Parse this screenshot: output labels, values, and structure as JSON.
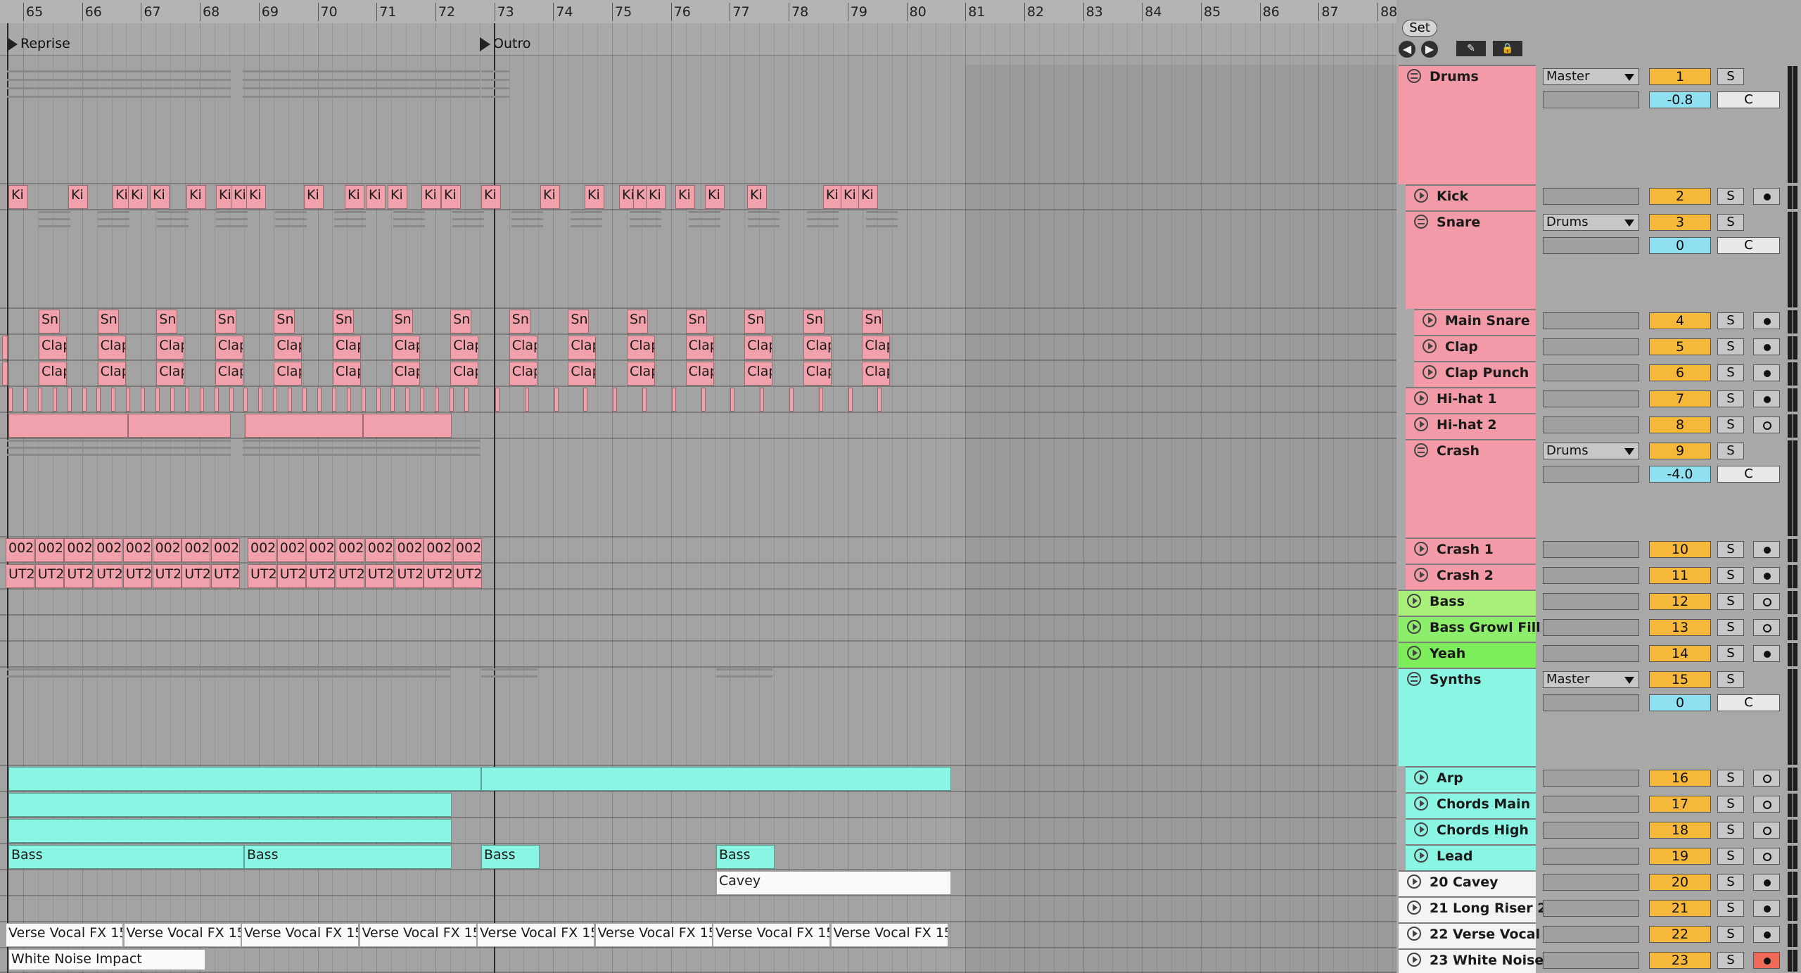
{
  "ruler": {
    "bars": [
      "65",
      "66",
      "67",
      "68",
      "69",
      "70",
      "71",
      "72",
      "73",
      "74",
      "75",
      "76",
      "77",
      "78",
      "79",
      "80",
      "81",
      "82",
      "83",
      "84",
      "85",
      "86",
      "87",
      "88"
    ]
  },
  "locators": [
    {
      "label": "Reprise"
    },
    {
      "label": "Outro"
    }
  ],
  "toolbar": {
    "set_label": "Set"
  },
  "clips": {
    "kick_label": "Ki",
    "snare_label": "Sn",
    "clap_label": "Clap",
    "crash1_label": "002",
    "crash2_label": "UT2",
    "bass_label": "Bass",
    "cavey_label": "Cavey",
    "verse_label": "Verse Vocal FX 15",
    "white_noise_label": "White Noise Impact"
  },
  "tracks": [
    {
      "name": "Drums",
      "kind": "group",
      "color": "#f29aa7",
      "routing": "Master",
      "number": "1",
      "volume": "-0.8",
      "pan": "C"
    },
    {
      "name": "Kick",
      "kind": "track",
      "color": "#f29aa7",
      "number": "2",
      "arm": "rec"
    },
    {
      "name": "Snare",
      "kind": "group",
      "color": "#f29aa7",
      "routing": "Drums",
      "number": "3",
      "volume": "0",
      "pan": "C"
    },
    {
      "name": "Main Snare",
      "kind": "track",
      "color": "#f29aa7",
      "number": "4",
      "arm": "rec"
    },
    {
      "name": "Clap",
      "kind": "track",
      "color": "#f29aa7",
      "number": "5",
      "arm": "rec"
    },
    {
      "name": "Clap Punch",
      "kind": "track",
      "color": "#f29aa7",
      "number": "6",
      "arm": "rec"
    },
    {
      "name": "Hi-hat 1",
      "kind": "track",
      "color": "#f29aa7",
      "number": "7",
      "arm": "rec"
    },
    {
      "name": "Hi-hat 2",
      "kind": "track",
      "color": "#f29aa7",
      "number": "8",
      "arm": "mon"
    },
    {
      "name": "Crash",
      "kind": "group",
      "color": "#f29aa7",
      "routing": "Drums",
      "number": "9",
      "volume": "-4.0",
      "pan": "C"
    },
    {
      "name": "Crash 1",
      "kind": "track",
      "color": "#f29aa7",
      "number": "10",
      "arm": "rec"
    },
    {
      "name": "Crash 2",
      "kind": "track",
      "color": "#f29aa7",
      "number": "11",
      "arm": "rec"
    },
    {
      "name": "Bass",
      "kind": "track",
      "color": "#a8f07a",
      "number": "12",
      "arm": "mon"
    },
    {
      "name": "Bass Growl Fill",
      "kind": "track",
      "color": "#8cee6b",
      "number": "13",
      "arm": "mon"
    },
    {
      "name": "Yeah",
      "kind": "track",
      "color": "#7ded5c",
      "number": "14",
      "arm": "rec"
    },
    {
      "name": "Synths",
      "kind": "group",
      "color": "#8bf5e3",
      "routing": "Master",
      "number": "15",
      "volume": "0",
      "pan": "C"
    },
    {
      "name": "Arp",
      "kind": "track",
      "color": "#8bf5e3",
      "number": "16",
      "arm": "mon"
    },
    {
      "name": "Chords Main",
      "kind": "track",
      "color": "#8bf5e3",
      "number": "17",
      "arm": "mon"
    },
    {
      "name": "Chords High",
      "kind": "track",
      "color": "#8bf5e3",
      "number": "18",
      "arm": "mon"
    },
    {
      "name": "Lead",
      "kind": "track",
      "color": "#8bf5e3",
      "number": "19",
      "arm": "mon"
    },
    {
      "name": "20 Cavey",
      "kind": "track",
      "color": "#f4f4f4",
      "number": "20",
      "arm": "rec"
    },
    {
      "name": "21 Long Riser 2",
      "kind": "track",
      "color": "#f4f4f4",
      "number": "21",
      "arm": "rec"
    },
    {
      "name": "22 Verse Vocal",
      "kind": "track",
      "color": "#f4f4f4",
      "number": "22",
      "arm": "rec"
    },
    {
      "name": "23 White Noise",
      "kind": "track",
      "color": "#f4f4f4",
      "number": "23",
      "arm": "red"
    }
  ],
  "solo_label": "S"
}
